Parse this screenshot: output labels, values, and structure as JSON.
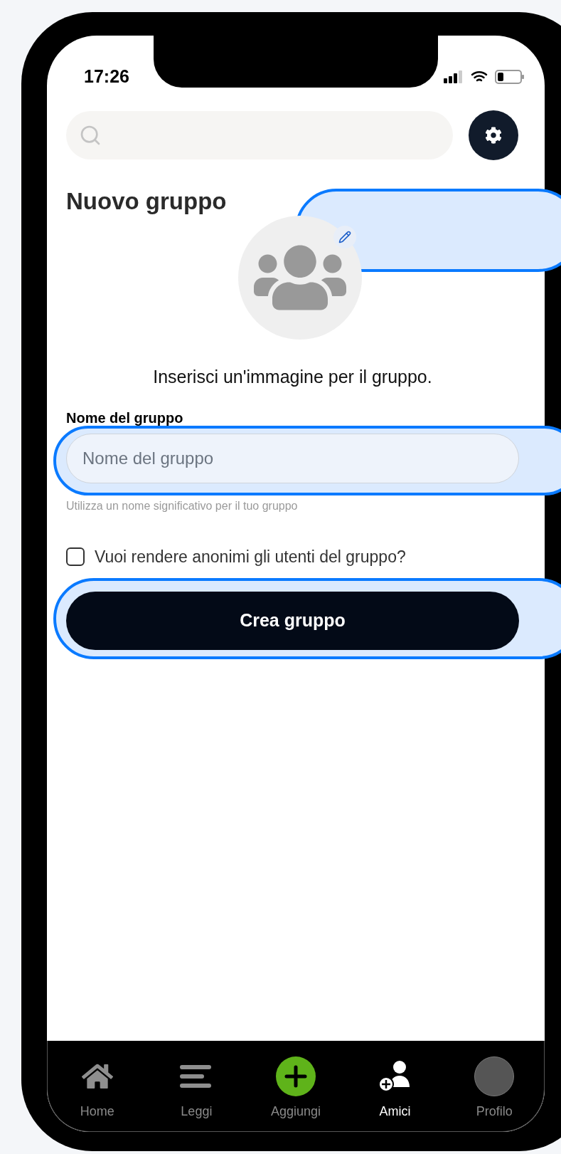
{
  "status_bar": {
    "time": "17:26"
  },
  "title": "Nuovo gruppo",
  "image_prompt": "Inserisci un'immagine per il gruppo.",
  "name_field": {
    "label": "Nome del gruppo",
    "placeholder": "Nome del gruppo",
    "hint": "Utilizza un nome significativo per il tuo gruppo"
  },
  "anonymous_option": {
    "label": "Vuoi rendere anonimi gli utenti del gruppo?",
    "checked": false
  },
  "submit_button": "Crea gruppo",
  "nav": [
    {
      "label": "Home",
      "kind": "home",
      "selected": false
    },
    {
      "label": "Leggi",
      "kind": "read",
      "selected": false
    },
    {
      "label": "Aggiungi",
      "kind": "add",
      "selected": false
    },
    {
      "label": "Amici",
      "kind": "friends",
      "selected": true
    },
    {
      "label": "Profilo",
      "kind": "profile",
      "selected": false
    }
  ]
}
